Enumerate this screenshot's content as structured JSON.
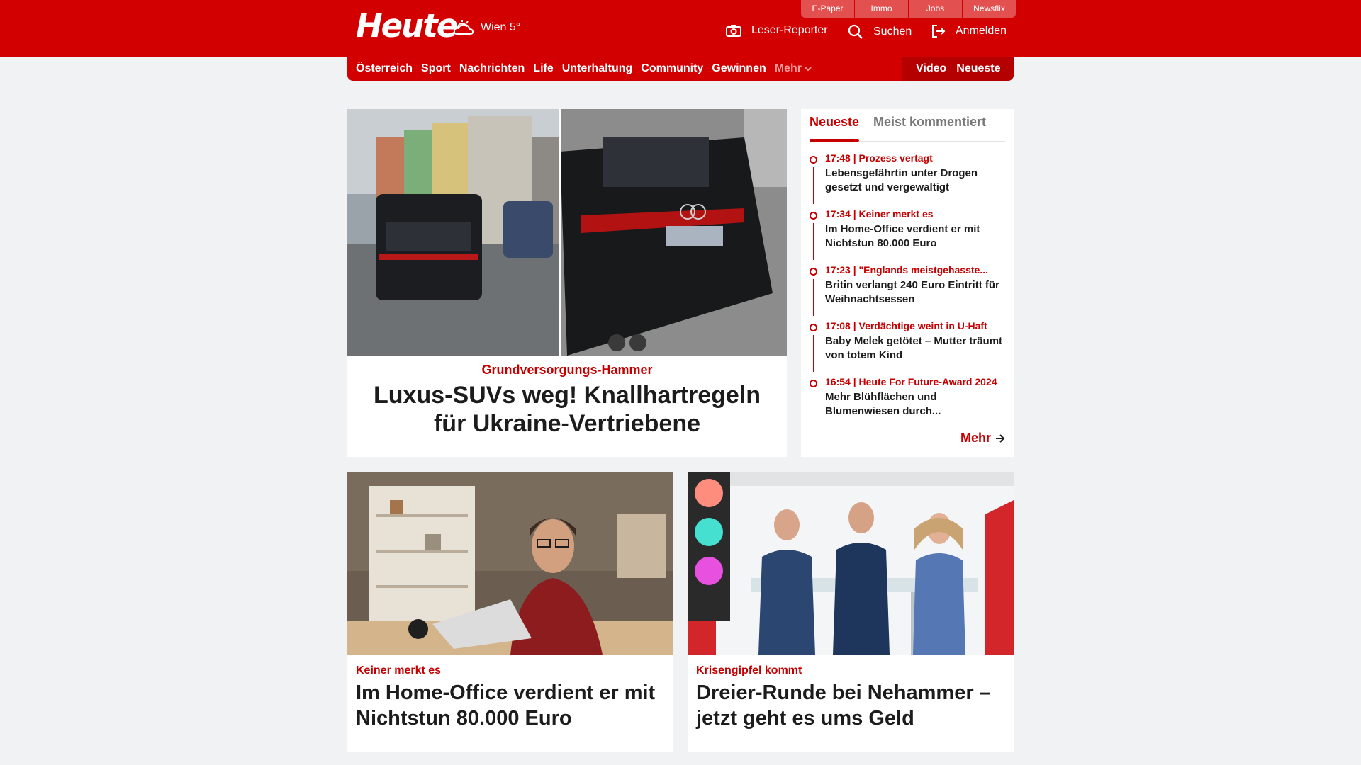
{
  "header": {
    "logo": "Heute",
    "weather": "Wien 5°",
    "topnav": [
      "E-Paper",
      "Immo",
      "Jobs",
      "Newsflix"
    ],
    "actions": {
      "reporter": "Leser-Reporter",
      "search": "Suchen",
      "login": "Anmelden"
    }
  },
  "nav": {
    "items": [
      "Österreich",
      "Sport",
      "Nachrichten",
      "Life",
      "Unterhaltung",
      "Community",
      "Gewinnen"
    ],
    "more": "Mehr",
    "video": "Video",
    "latest": "Neueste"
  },
  "hero": {
    "kicker": "Grundversorgungs-Hammer",
    "title": "Luxus-SUVs weg! Knallhartregeln für Ukraine-Vertriebene"
  },
  "sidebar": {
    "tab_active": "Neueste",
    "tab_inactive": "Meist kommentiert",
    "items": [
      {
        "meta": "17:48 | Prozess vertagt",
        "title": "Lebensgefährtin unter Drogen gesetzt und vergewaltigt"
      },
      {
        "meta": "17:34 | Keiner merkt es",
        "title": "Im Home-Office verdient er mit Nichtstun 80.000 Euro"
      },
      {
        "meta": "17:23 | \"Englands meistgehasste...",
        "title": "Britin verlangt 240 Euro Eintritt für Weihnachtsessen"
      },
      {
        "meta": "17:08 | Verdächtige weint in U-Haft",
        "title": "Baby Melek getötet – Mutter träumt von totem Kind"
      },
      {
        "meta": "16:54 | Heute For Future-Award 2024",
        "title": "Mehr Blühflächen und Blumenwiesen durch..."
      }
    ],
    "more": "Mehr"
  },
  "cards": [
    {
      "kicker": "Keiner merkt es",
      "title": "Im Home-Office verdient er mit Nichtstun 80.000 Euro"
    },
    {
      "kicker": "Krisengipfel kommt",
      "title": "Dreier-Runde bei Nehammer – jetzt geht es ums Geld"
    }
  ],
  "colors": {
    "brand": "#d20000",
    "accent": "#c60000",
    "background": "#f1f2f4"
  }
}
